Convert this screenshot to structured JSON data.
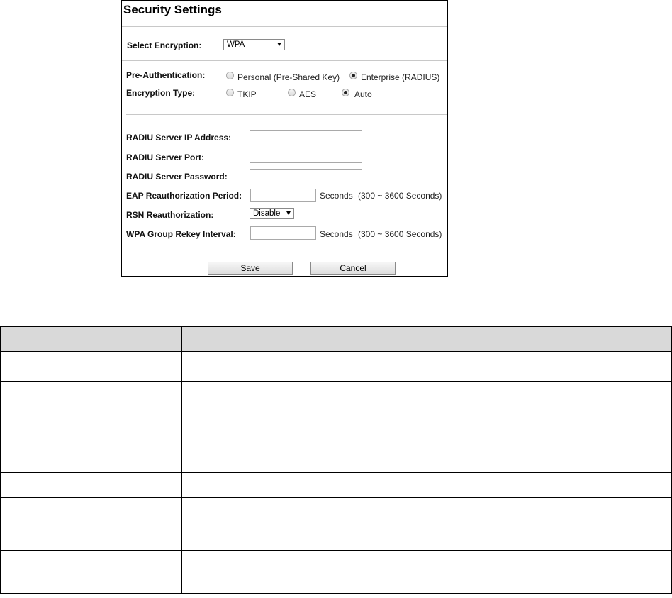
{
  "panel": {
    "title": "Security Settings",
    "select_encryption": {
      "label": "Select Encryption:",
      "value": "WPA"
    },
    "pre_auth": {
      "label": "Pre-Authentication:",
      "options": [
        "Personal (Pre-Shared Key)",
        "Enterprise (RADIUS)"
      ],
      "selected": "Enterprise (RADIUS)"
    },
    "encryption_type": {
      "label": "Encryption Type:",
      "options": [
        "TKIP",
        "AES",
        "Auto"
      ],
      "selected": "Auto"
    },
    "radius_ip": {
      "label": "RADIU Server IP Address:",
      "value": ""
    },
    "radius_port": {
      "label": "RADIU Server Port:",
      "value": ""
    },
    "radius_password": {
      "label": "RADIU Server Password:",
      "value": ""
    },
    "eap_period": {
      "label": "EAP Reauthorization Period:",
      "value": "",
      "unit": "Seconds",
      "range": "(300 ~ 3600 Seconds)"
    },
    "rsn": {
      "label": "RSN Reauthorization:",
      "value": "Disable"
    },
    "wpa_rekey": {
      "label": "WPA Group Rekey Interval:",
      "value": "",
      "unit": "Seconds",
      "range": "(300 ~ 3600 Seconds)"
    },
    "buttons": {
      "save": "Save",
      "cancel": "Cancel"
    }
  }
}
